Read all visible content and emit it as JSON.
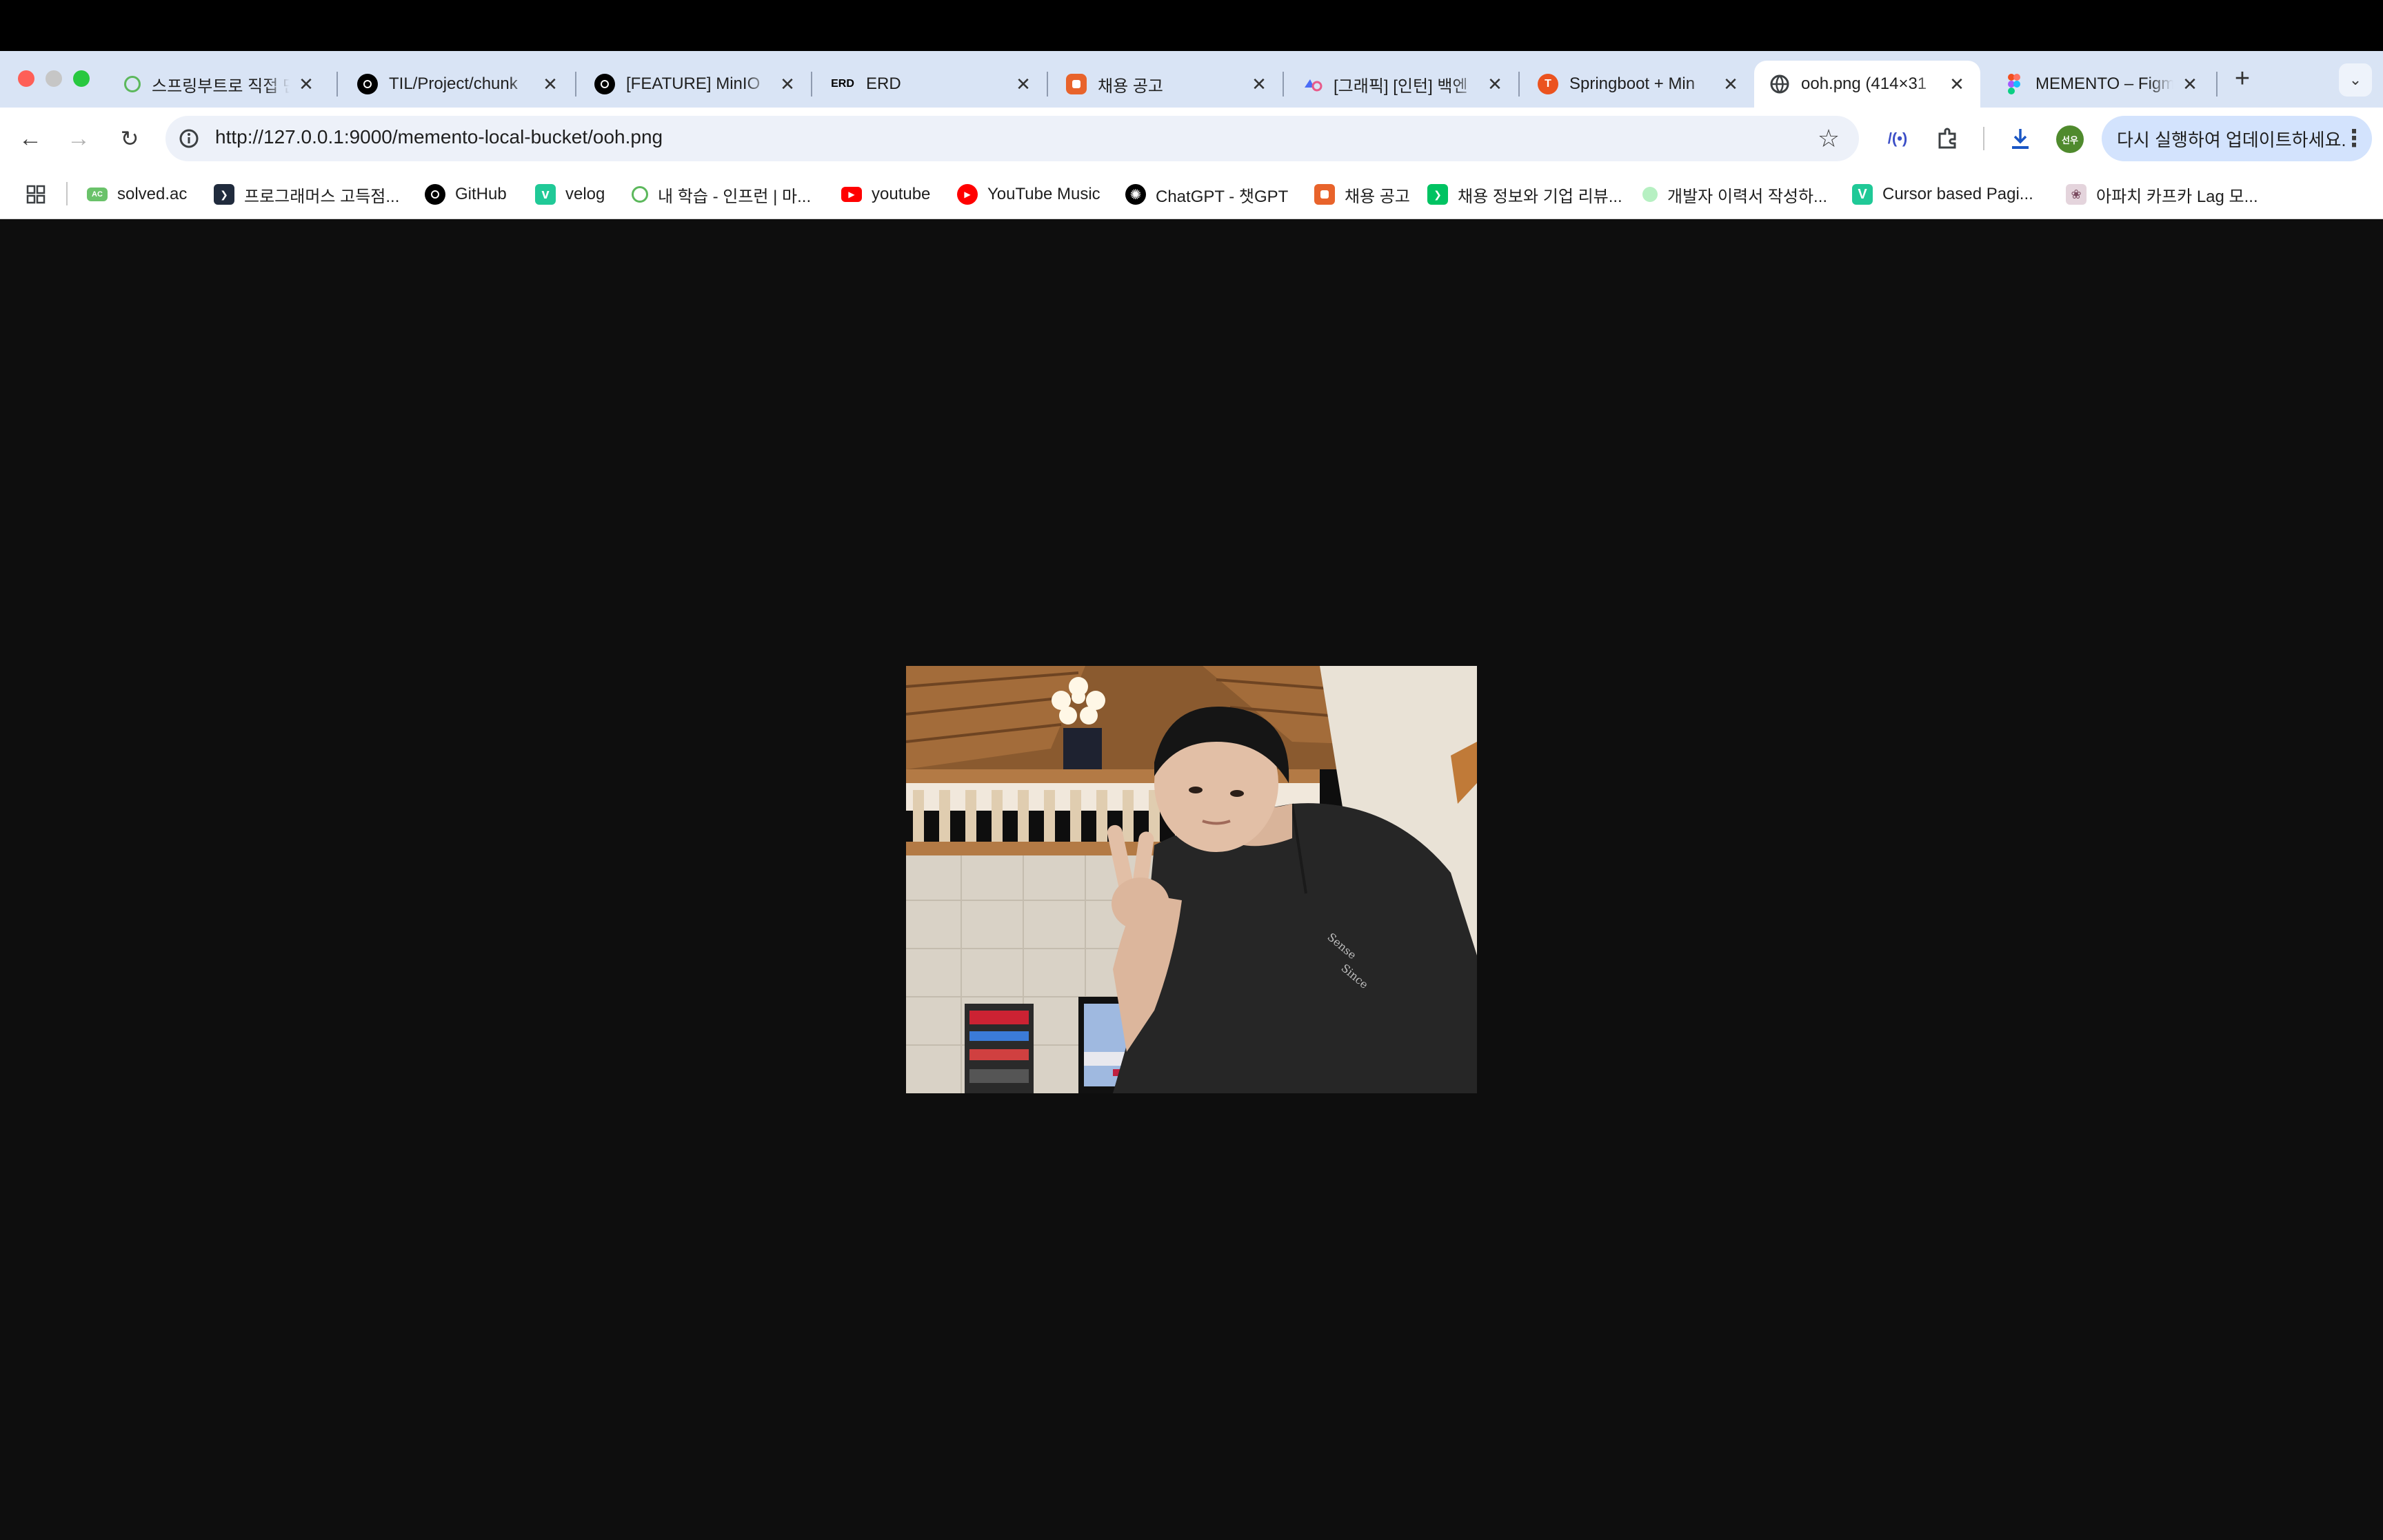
{
  "tabs": [
    {
      "title": "스프링부트로 직접 만",
      "favicon": "inflearn-icon",
      "color": "#5cb85c"
    },
    {
      "title": "TIL/Project/chunk",
      "favicon": "github-icon",
      "color": "#000000"
    },
    {
      "title": "[FEATURE] MinIO",
      "favicon": "github-icon",
      "color": "#000000"
    },
    {
      "title": "ERD",
      "favicon": "erd-icon",
      "color": "#000000",
      "favicon_text": "ERD"
    },
    {
      "title": "채용 공고",
      "favicon": "job-icon",
      "color": "#e8632b"
    },
    {
      "title": "[그래픽] [인턴] 백엔",
      "favicon": "graphic-icon",
      "color": "#4a6cf7"
    },
    {
      "title": "Springboot + Min",
      "favicon": "tistory-icon",
      "color": "#eb531f",
      "favicon_text": "T"
    },
    {
      "title": "ooh.png (414×31",
      "favicon": "globe-icon",
      "color": "#5f6368"
    },
    {
      "title": "MEMENTO – Figma",
      "favicon": "figma-icon",
      "color": "#f24e1e"
    }
  ],
  "toolbar": {
    "url": "http://127.0.0.1:9000/memento-local-bucket/ooh.png",
    "update_label": "다시 실행하여 업데이트하세요.",
    "profile_label": "선우"
  },
  "bookmarks": [
    {
      "label": "solved.ac",
      "icon": "solvedac-icon",
      "color": "#6ac26a",
      "text": "AC"
    },
    {
      "label": "프로그래머스 고득점...",
      "icon": "programmers-icon",
      "color": "#202b3d",
      "text": "❯"
    },
    {
      "label": "GitHub",
      "icon": "github-icon",
      "color": "#000000",
      "text": ""
    },
    {
      "label": "velog",
      "icon": "velog-icon",
      "color": "#20c997",
      "text": "v"
    },
    {
      "label": "내 학습 - 인프런 | 마...",
      "icon": "inflearn-icon",
      "color": "#5cb85c",
      "text": ""
    },
    {
      "label": "youtube",
      "icon": "youtube-icon",
      "color": "#ff0000",
      "text": "▶"
    },
    {
      "label": "YouTube Music",
      "icon": "youtube-music-icon",
      "color": "#ff0000",
      "text": "▶"
    },
    {
      "label": "ChatGPT - 챗GPT",
      "icon": "chatgpt-icon",
      "color": "#000000",
      "text": "✺"
    },
    {
      "label": "채용 공고",
      "icon": "job-icon",
      "color": "#e8632b",
      "text": ""
    },
    {
      "label": "채용 정보와 기업 리뷰...",
      "icon": "jobplanet-icon",
      "color": "#00c362",
      "text": "❯"
    },
    {
      "label": "개발자 이력서 작성하...",
      "icon": "resume-icon",
      "color": "#b6f0c2",
      "text": ""
    },
    {
      "label": "Cursor based Pagi...",
      "icon": "velog-icon",
      "color": "#20c997",
      "text": "V"
    },
    {
      "label": "아파치 카프카 Lag 모...",
      "icon": "kafka-icon",
      "color": "#c7a5b5",
      "text": ""
    }
  ],
  "image": {
    "alt": "ooh.png",
    "description_icon": "photo-person-peace-sign"
  }
}
